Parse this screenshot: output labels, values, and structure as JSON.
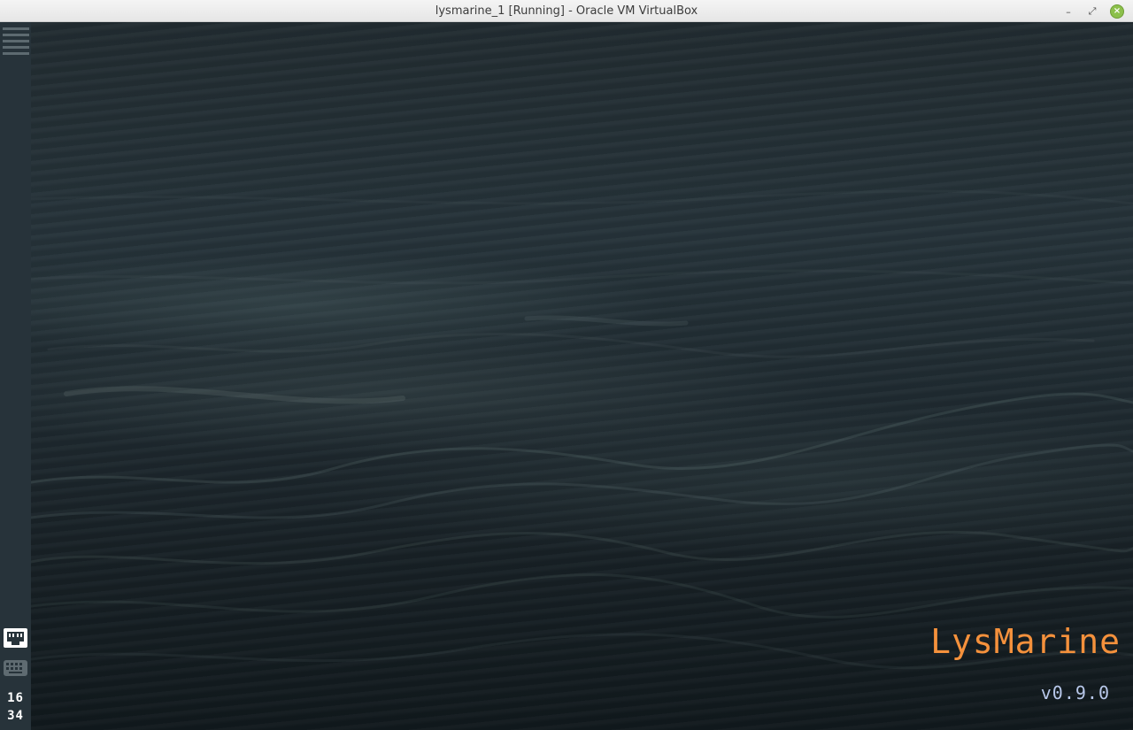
{
  "window": {
    "title": "lysmarine_1 [Running] - Oracle VM VirtualBox",
    "minimize_label": "–",
    "maximize_label": "⤢",
    "close_label": "×"
  },
  "panel": {
    "menu_icon": "hamburger-menu-icon",
    "network_icon": "ethernet-network-icon",
    "keyboard_icon": "keyboard-icon",
    "clock_hours": "16",
    "clock_minutes": "34"
  },
  "desktop": {
    "brand_name": "LysMarine",
    "version": "v0.9.0",
    "brand_color": "#f5913c",
    "version_color": "#b8c8ea"
  }
}
